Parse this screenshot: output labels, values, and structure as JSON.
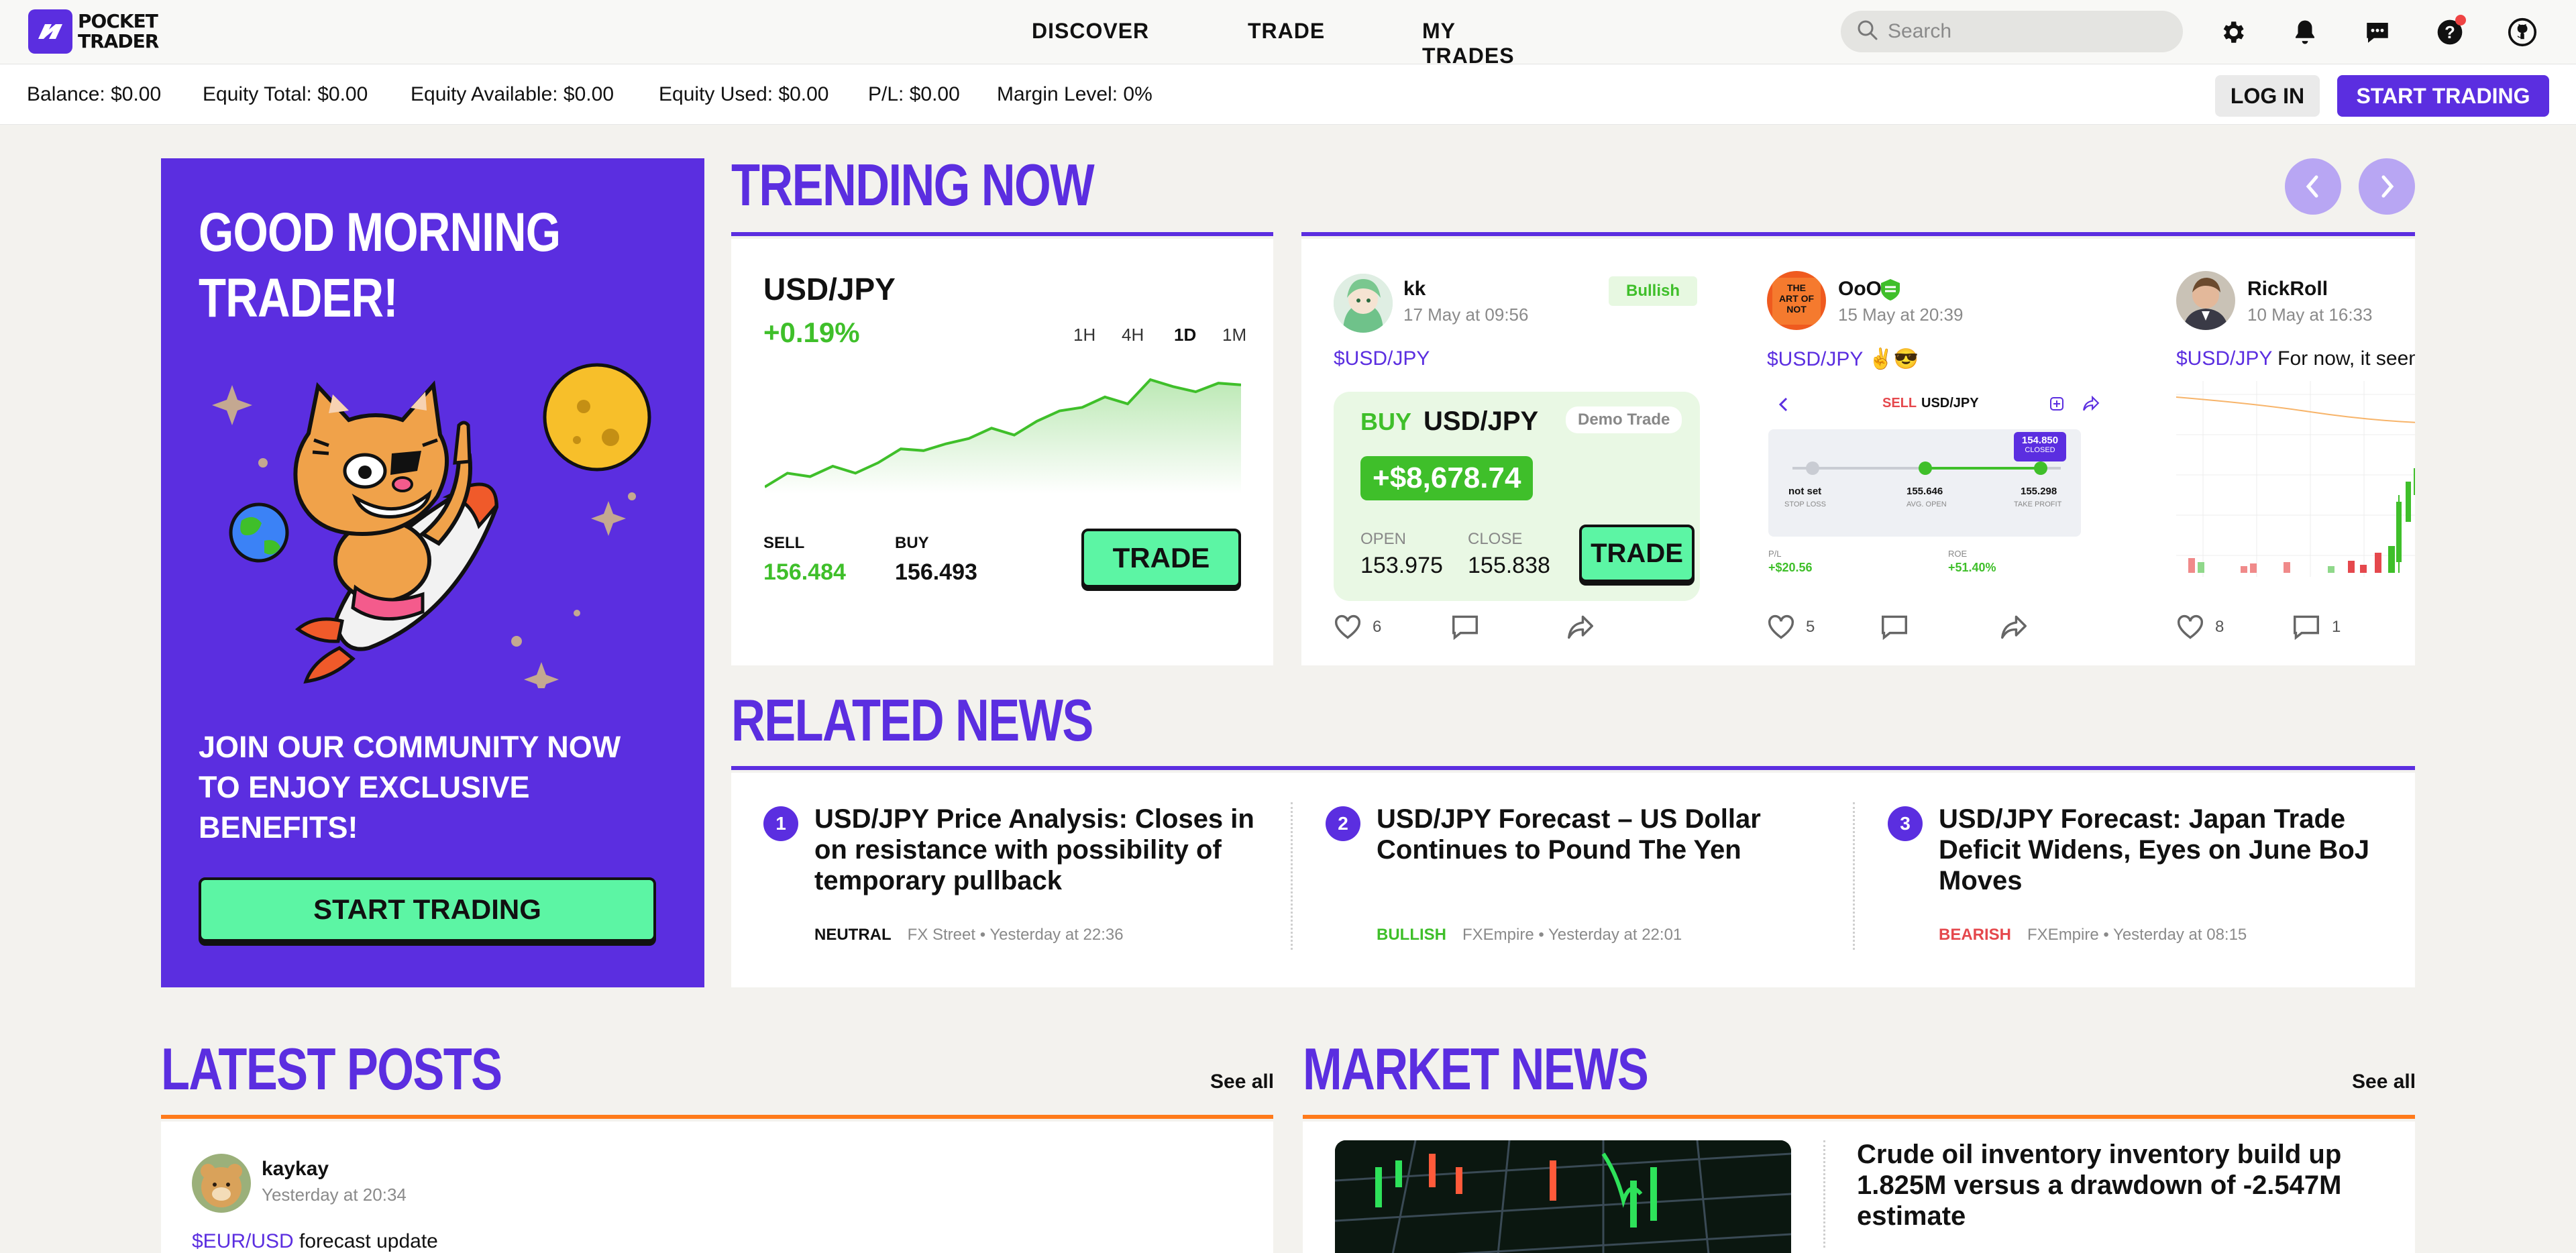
{
  "header": {
    "logo_line1": "POCKET",
    "logo_line2": "TRADER",
    "nav": [
      "DISCOVER",
      "TRADE",
      "MY TRADES"
    ],
    "search_placeholder": "Search",
    "icons": [
      "gear-icon",
      "bell-icon",
      "chat-icon",
      "help-icon",
      "github-icon"
    ]
  },
  "account": {
    "balance": "Balance: $0.00",
    "equity_total": "Equity Total: $0.00",
    "equity_available": "Equity Available: $0.00",
    "equity_used": "Equity Used: $0.00",
    "pl": "P/L: $0.00",
    "margin_level": "Margin Level: 0%",
    "login": "LOG IN",
    "start_trading": "START TRADING"
  },
  "hero": {
    "title_line1": "GOOD MORNING",
    "title_line2": "TRADER!",
    "subtitle": "JOIN OUR COMMUNITY NOW TO ENJOY EXCLUSIVE BENEFITS!",
    "button": "START TRADING"
  },
  "trending": {
    "title": "TRENDING NOW",
    "pair": {
      "name": "USD/JPY",
      "change": "+0.19%",
      "timeframes": [
        "1H",
        "4H",
        "1D",
        "1M"
      ],
      "active_timeframe": "1D",
      "sell_label": "SELL",
      "sell_value": "156.484",
      "buy_label": "BUY",
      "buy_value": "156.493",
      "trade_button": "TRADE",
      "spark": [
        30,
        38,
        36,
        42,
        38,
        44,
        52,
        51,
        55,
        58,
        64,
        60,
        68,
        74,
        76,
        82,
        78,
        92,
        88,
        85,
        90,
        89
      ]
    },
    "posts": [
      {
        "user": "kk",
        "date": "17 May at 09:56",
        "badge": "Bullish",
        "tag": "$USD/JPY",
        "trade": {
          "side": "BUY",
          "pair": "USD/JPY",
          "label": "Demo Trade",
          "profit": "+$8,678.74",
          "open_label": "OPEN",
          "open_value": "153.975",
          "close_label": "CLOSE",
          "close_value": "155.838",
          "button": "TRADE"
        },
        "likes": "6"
      },
      {
        "user": "OoO",
        "date": "15 May at 20:39",
        "tag": "$USD/JPY",
        "tag_rest": " ✌😎",
        "preview": {
          "side": "SELL",
          "pair": "USD/JPY",
          "closed_price": "154.850",
          "closed_label": "CLOSED",
          "stop_loss_value": "not set",
          "stop_loss_label": "STOP LOSS",
          "avg_open_value": "155.646",
          "avg_open_label": "AVG. OPEN",
          "take_profit_value": "155.298",
          "take_profit_label": "TAKE PROFIT",
          "pl_label": "P/L",
          "pl_value": "+$20.56",
          "roe_label": "ROE",
          "roe_value": "+51.40%"
        },
        "likes": "5"
      },
      {
        "user": "RickRoll",
        "date": "10 May at 16:33",
        "tag": "$USD/JPY",
        "tag_rest": " For now, it seem",
        "likes": "8",
        "comments": "1"
      }
    ]
  },
  "related_news": {
    "title": "RELATED NEWS",
    "items": [
      {
        "num": "1",
        "title": "USD/JPY Price Analysis: Closes in on resistance with possibility of temporary pullback",
        "sentiment": "NEUTRAL",
        "source": "FX Street • Yesterday at 22:36",
        "color": "#111111"
      },
      {
        "num": "2",
        "title": "USD/JPY Forecast – US Dollar Continues to Pound The Yen",
        "sentiment": "BULLISH",
        "source": "FXEmpire • Yesterday at 22:01",
        "color": "#3fbf2a"
      },
      {
        "num": "3",
        "title": "USD/JPY Forecast: Japan Trade Deficit Widens, Eyes on June BoJ Moves",
        "sentiment": "BEARISH",
        "source": "FXEmpire • Yesterday at 08:15",
        "color": "#e5484d"
      }
    ]
  },
  "latest_posts": {
    "title": "LATEST POSTS",
    "see_all": "See all",
    "post": {
      "user": "kaykay",
      "date": "Yesterday at 20:34",
      "tag": "$EUR/USD",
      "text": " forecast update"
    }
  },
  "market_news": {
    "title": "MARKET NEWS",
    "see_all": "See all",
    "headline": "Crude oil inventory inventory build up 1.825M versus a drawdown of -2.547M estimate"
  },
  "colors": {
    "brand": "#5b2ee0",
    "mint": "#5cf5a4",
    "green": "#3fbf2a",
    "orange": "#ff7a1a",
    "red": "#e5484d"
  }
}
